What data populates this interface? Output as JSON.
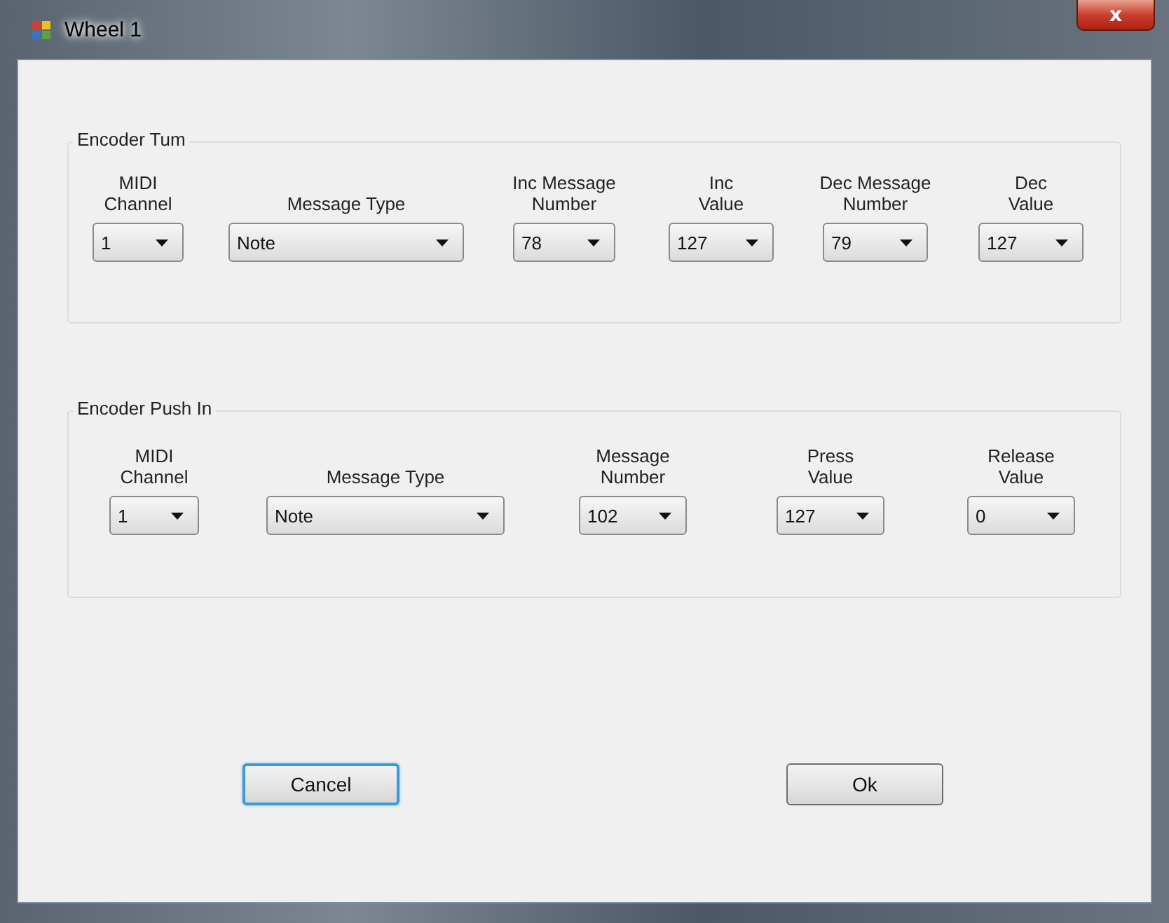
{
  "window": {
    "title": "Wheel 1",
    "close_glyph": "x"
  },
  "groups": [
    {
      "title": "Encoder Tum",
      "kind": "turn",
      "fields": [
        {
          "label": [
            "MIDI",
            "Channel"
          ],
          "value": "1"
        },
        {
          "label": [
            "Message Type"
          ],
          "value": "Note"
        },
        {
          "label": [
            "Inc Message",
            "Number"
          ],
          "value": "78"
        },
        {
          "label": [
            "Inc",
            "Value"
          ],
          "value": "127"
        },
        {
          "label": [
            "Dec Message",
            "Number"
          ],
          "value": "79"
        },
        {
          "label": [
            "Dec",
            "Value"
          ],
          "value": "127"
        }
      ]
    },
    {
      "title": "Encoder Push In",
      "kind": "push",
      "fields": [
        {
          "label": [
            "MIDI",
            "Channel"
          ],
          "value": "1"
        },
        {
          "label": [
            "Message Type"
          ],
          "value": "Note"
        },
        {
          "label": [
            "Message",
            "Number"
          ],
          "value": "102"
        },
        {
          "label": [
            "Press",
            "Value"
          ],
          "value": "127"
        },
        {
          "label": [
            "Release",
            "Value"
          ],
          "value": "0"
        }
      ]
    }
  ],
  "buttons": [
    {
      "label": "Cancel",
      "focused": true
    },
    {
      "label": "Ok",
      "focused": false
    }
  ]
}
